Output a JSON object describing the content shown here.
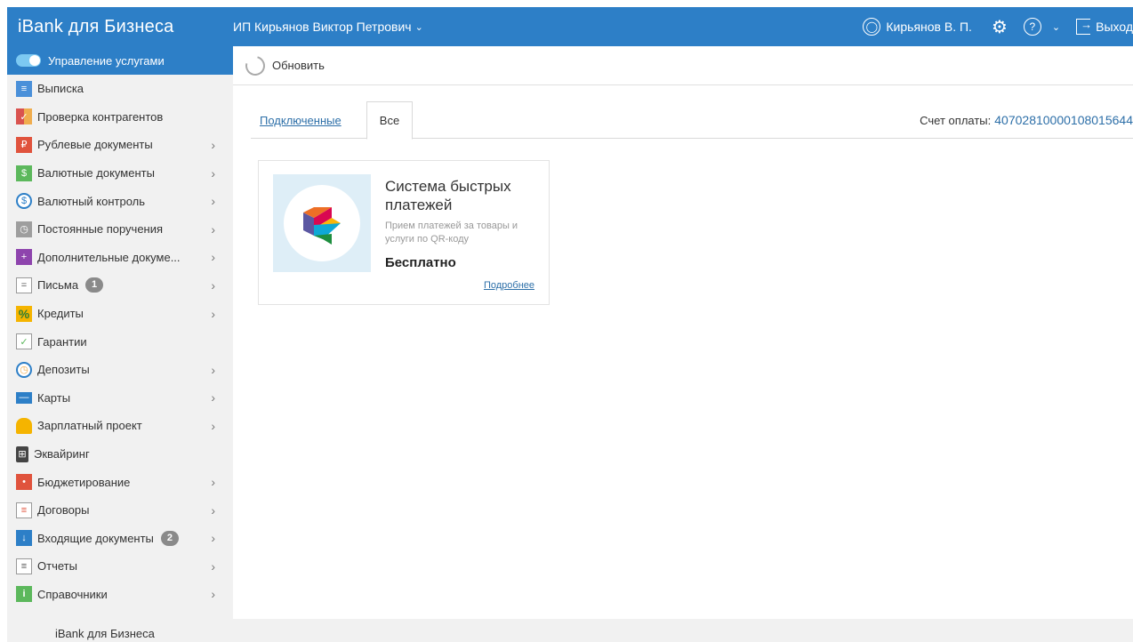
{
  "header": {
    "brand": "iBank для Бизнеса",
    "organization": "ИП Кирьянов Виктор Петрович",
    "user": "Кирьянов В. П.",
    "logout": "Выход",
    "bg_color": "#2d7fc7"
  },
  "toolbar": {
    "refresh_label": "Обновить"
  },
  "sidebar": {
    "items": [
      {
        "label": "Управление услугами",
        "icon": "toggle-icon",
        "active": true
      },
      {
        "label": "Выписка",
        "icon": "statement-icon"
      },
      {
        "label": "Проверка контрагентов",
        "icon": "counterparty-check-icon"
      },
      {
        "label": "Рублевые документы",
        "icon": "ruble-docs-icon"
      },
      {
        "label": "Валютные документы",
        "icon": "currency-docs-icon"
      },
      {
        "label": "Валютный контроль",
        "icon": "currency-control-icon"
      },
      {
        "label": "Постоянные поручения",
        "icon": "standing-orders-icon"
      },
      {
        "label": "Дополнительные докуме...",
        "icon": "additional-docs-icon"
      },
      {
        "label": "Письма",
        "icon": "letters-icon",
        "badge": "1"
      },
      {
        "label": "Кредиты",
        "icon": "credits-icon"
      },
      {
        "label": "Гарантии",
        "icon": "guarantees-icon"
      },
      {
        "label": "Депозиты",
        "icon": "deposits-icon"
      },
      {
        "label": "Карты",
        "icon": "cards-icon"
      },
      {
        "label": "Зарплатный проект",
        "icon": "salary-project-icon"
      },
      {
        "label": "Эквайринг",
        "icon": "acquiring-icon"
      },
      {
        "label": "Бюджетирование",
        "icon": "budgeting-icon"
      },
      {
        "label": "Договоры",
        "icon": "contracts-icon"
      },
      {
        "label": "Входящие документы",
        "icon": "incoming-docs-icon",
        "badge": "2"
      },
      {
        "label": "Отчеты",
        "icon": "reports-icon"
      },
      {
        "label": "Справочники",
        "icon": "directories-icon"
      }
    ]
  },
  "tabs": {
    "connected": "Подключенные",
    "all": "Все"
  },
  "account": {
    "label": "Счет оплаты:",
    "number": "40702810000108015644"
  },
  "service_card": {
    "title": "Система быстрых платежей",
    "description": "Прием платежей за товары и услуги по QR-коду",
    "price": "Бесплатно",
    "more_link": "Подробнее"
  },
  "footer": {
    "text": "iBank для Бизнеса"
  }
}
